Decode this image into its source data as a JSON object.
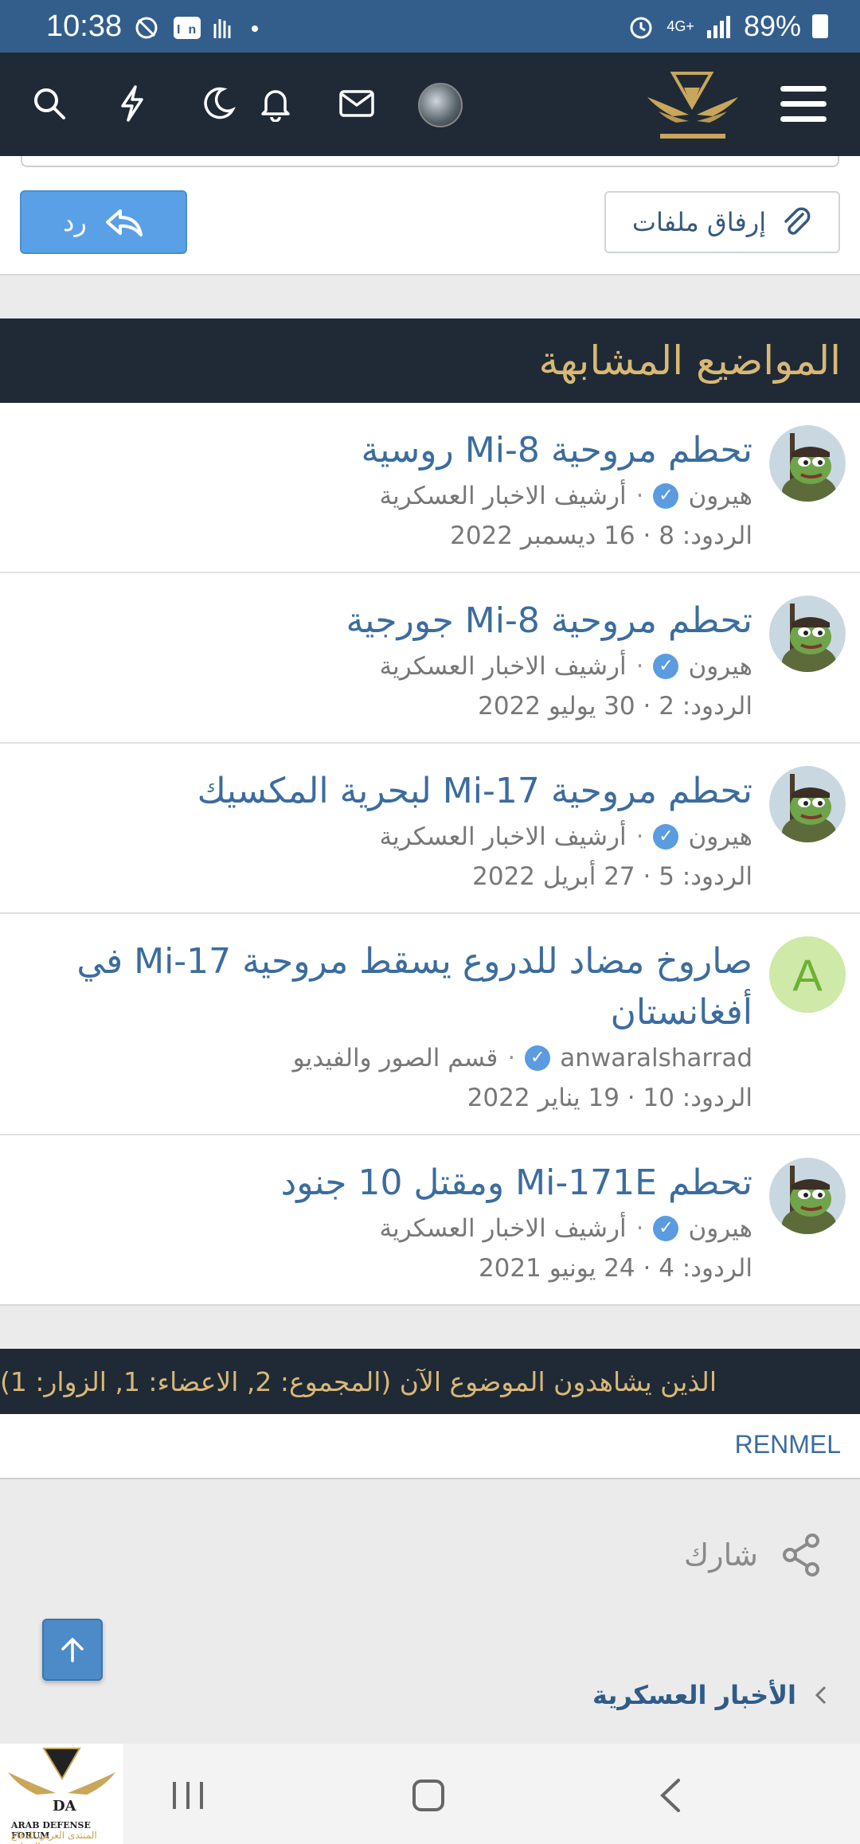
{
  "status_bar": {
    "time": "10:38",
    "network": "4G+",
    "battery": "89%"
  },
  "app_bar": {
    "icons": [
      "search-icon",
      "lightning-icon",
      "moon-icon",
      "bell-icon",
      "mail-icon",
      "avatar",
      "site-logo",
      "menu-icon"
    ]
  },
  "reply_bar": {
    "attach_label": "إرفاق ملفات",
    "reply_label": "رد"
  },
  "similar_threads": {
    "heading": "المواضيع المشابهة",
    "items": [
      {
        "title": "تحطم مروحية Mi-8 روسية",
        "author": "هيرون",
        "forum": "أرشيف الاخبار العسكرية",
        "stats": "الردود: 8 · 16 ديسمبر 2022",
        "avatar_letter": ""
      },
      {
        "title": "تحطم مروحية Mi-8 جورجية",
        "author": "هيرون",
        "forum": "أرشيف الاخبار العسكرية",
        "stats": "الردود: 2 · 30 يوليو 2022",
        "avatar_letter": ""
      },
      {
        "title": "تحطم مروحية Mi-17 لبحرية المكسيك",
        "author": "هيرون",
        "forum": "أرشيف الاخبار العسكرية",
        "stats": "الردود: 5 · 27 أبريل 2022",
        "avatar_letter": ""
      },
      {
        "title": "صاروخ مضاد للدروع يسقط مروحية Mi-17 في أفغانستان",
        "author": "anwaralsharrad",
        "forum": "قسم الصور والفيديو",
        "stats": "الردود: 10 · 19 يناير 2022",
        "avatar_letter": "A"
      },
      {
        "title": "تحطم Mi-171E ومقتل 10 جنود",
        "author": "هيرون",
        "forum": "أرشيف الاخبار العسكرية",
        "stats": "الردود: 4 · 24 يونيو 2021",
        "avatar_letter": ""
      }
    ]
  },
  "viewers": {
    "heading": "الذين يشاهدون الموضوع الآن (المجموع: 2, الاعضاء: 1, الزوار: 1)",
    "member": "RENMEL"
  },
  "share": {
    "label": "شارك"
  },
  "breadcrumb": {
    "label": "الأخبار العسكرية"
  },
  "ad_logo": {
    "line1": "ARAB DEFENSE FORUM",
    "line2": "المنتدى العربي للدفاع والتسليح"
  },
  "colors": {
    "header_bg": "#1f2a36",
    "accent_gold": "#d9b876",
    "link_blue": "#3b6c9f",
    "button_blue": "#5aa0e6",
    "status_bar": "#335e8c"
  }
}
